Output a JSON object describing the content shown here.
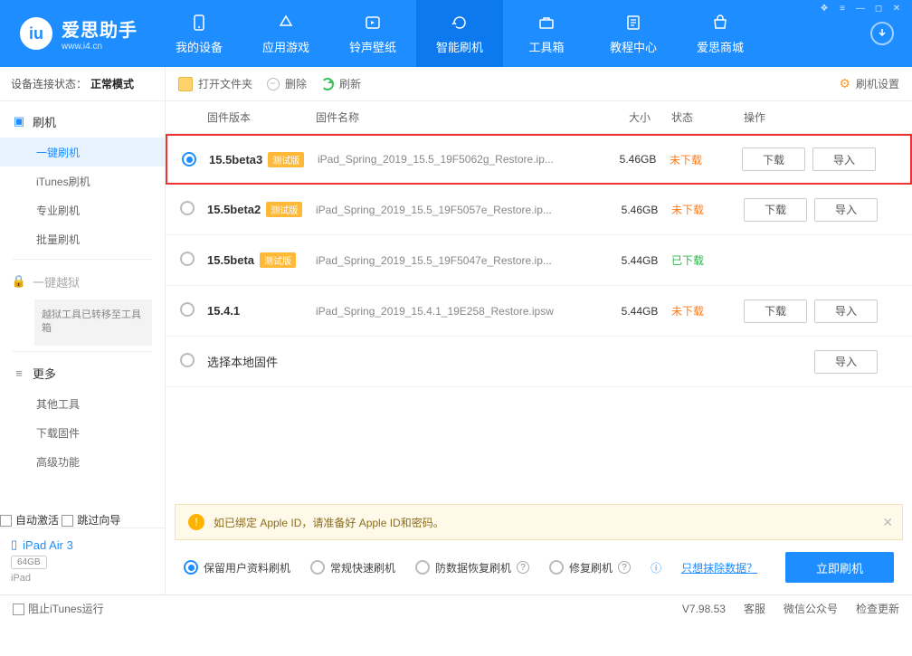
{
  "brand": {
    "name": "爱思助手",
    "url": "www.i4.cn"
  },
  "nav": {
    "items": [
      "我的设备",
      "应用游戏",
      "铃声壁纸",
      "智能刷机",
      "工具箱",
      "教程中心",
      "爱思商城"
    ],
    "active_index": 3
  },
  "toolbar": {
    "open_folder": "打开文件夹",
    "delete": "删除",
    "refresh": "刷新",
    "settings": "刷机设置"
  },
  "device_state": {
    "label": "设备连接状态：",
    "value": "正常模式"
  },
  "sidebar": {
    "group_flash": {
      "title": "刷机",
      "items": [
        "一键刷机",
        "iTunes刷机",
        "专业刷机",
        "批量刷机"
      ],
      "active": 0
    },
    "group_jailbreak": {
      "title": "一键越狱",
      "notice": "越狱工具已转移至工具箱"
    },
    "group_more": {
      "title": "更多",
      "items": [
        "其他工具",
        "下载固件",
        "高级功能"
      ]
    },
    "auto_activate": "自动激活",
    "skip_guide": "跳过向导"
  },
  "device": {
    "name": "iPad Air 3",
    "storage": "64GB",
    "type": "iPad"
  },
  "table": {
    "headers": {
      "version": "固件版本",
      "name": "固件名称",
      "size": "大小",
      "state": "状态",
      "ops": "操作"
    },
    "download_btn": "下载",
    "import_btn": "导入",
    "rows": [
      {
        "selected": true,
        "version": "15.5beta3",
        "beta": true,
        "name": "iPad_Spring_2019_15.5_19F5062g_Restore.ip...",
        "size": "5.46GB",
        "state": "未下载",
        "state_cls": "not",
        "show_dl": true
      },
      {
        "selected": false,
        "version": "15.5beta2",
        "beta": true,
        "name": "iPad_Spring_2019_15.5_19F5057e_Restore.ip...",
        "size": "5.46GB",
        "state": "未下载",
        "state_cls": "not",
        "show_dl": true
      },
      {
        "selected": false,
        "version": "15.5beta",
        "beta": true,
        "name": "iPad_Spring_2019_15.5_19F5047e_Restore.ip...",
        "size": "5.44GB",
        "state": "已下载",
        "state_cls": "done",
        "show_dl": false
      },
      {
        "selected": false,
        "version": "15.4.1",
        "beta": false,
        "name": "iPad_Spring_2019_15.4.1_19E258_Restore.ipsw",
        "size": "5.44GB",
        "state": "未下载",
        "state_cls": "not",
        "show_dl": true
      }
    ],
    "local_row": "选择本地固件",
    "beta_badge": "测试版"
  },
  "info": {
    "text": "如已绑定 Apple ID，请准备好 Apple ID和密码。"
  },
  "opts": {
    "keep_data": "保留用户资料刷机",
    "normal": "常规快速刷机",
    "anti_loss": "防数据恢复刷机",
    "repair": "修复刷机",
    "erase_link": "只想抹除数据？",
    "go": "立即刷机",
    "info_icon": "ⓘ"
  },
  "status": {
    "block_itunes": "阻止iTunes运行",
    "version": "V7.98.53",
    "service": "客服",
    "wechat": "微信公众号",
    "update": "检查更新"
  }
}
